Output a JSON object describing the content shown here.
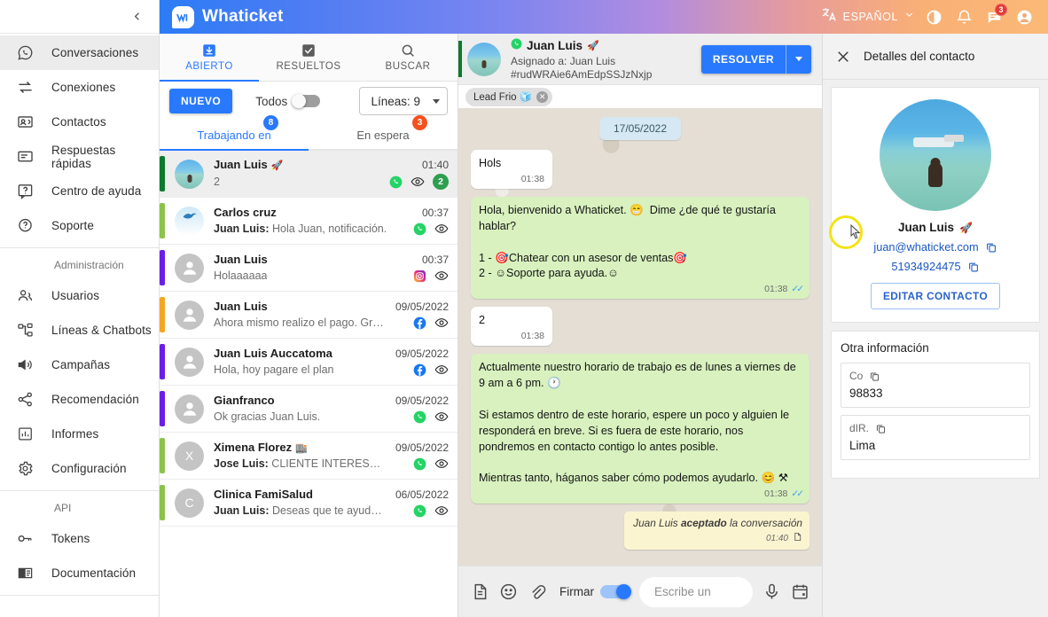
{
  "topbar": {
    "brand": "Whaticket",
    "language": "ESPAÑOL",
    "icons": {
      "translate": "translate-icon",
      "chevron": "chevron-down-icon",
      "dark_mode": "dark-mode-icon",
      "notifications": "bell-icon",
      "messages": "chat-icon",
      "profile": "account-circle-icon"
    },
    "messages_badge": "3"
  },
  "sidebar": {
    "collapse_icon": "chevron-left-icon",
    "items": [
      {
        "label": "Conversaciones",
        "icon": "whatsapp-chat-icon",
        "active": true
      },
      {
        "label": "Conexiones",
        "icon": "sync-arrows-icon",
        "active": false
      },
      {
        "label": "Contactos",
        "icon": "contacts-card-icon",
        "active": false
      },
      {
        "label": "Respuestas rápidas",
        "icon": "quick-reply-icon",
        "active": false
      },
      {
        "label": "Centro de ayuda",
        "icon": "help-center-icon",
        "active": false
      },
      {
        "label": "Soporte",
        "icon": "support-question-icon",
        "active": false
      }
    ],
    "section_admin": "Administración",
    "admin_items": [
      {
        "label": "Usuarios",
        "icon": "people-icon"
      },
      {
        "label": "Líneas & Chatbots",
        "icon": "chatbot-nodes-icon"
      },
      {
        "label": "Campañas",
        "icon": "megaphone-icon"
      },
      {
        "label": "Recomendación",
        "icon": "share-icon"
      },
      {
        "label": "Informes",
        "icon": "bar-chart-icon"
      },
      {
        "label": "Configuración",
        "icon": "gear-icon"
      }
    ],
    "section_api": "API",
    "api_items": [
      {
        "label": "Tokens",
        "icon": "key-icon"
      },
      {
        "label": "Documentación",
        "icon": "book-icon"
      }
    ]
  },
  "tickets": {
    "tabs": [
      {
        "label": "ABIERTO",
        "icon": "inbox-download-icon",
        "active": true
      },
      {
        "label": "RESUELTOS",
        "icon": "check-box-icon",
        "active": false
      },
      {
        "label": "BUSCAR",
        "icon": "search-icon",
        "active": false
      }
    ],
    "new_button": "NUEVO",
    "todos_label": "Todos",
    "todos_on": false,
    "lines_select": "Líneas: 9",
    "subtabs": [
      {
        "label": "Trabajando en",
        "badge": "8",
        "badge_color": "#2979ff",
        "active": true
      },
      {
        "label": "En espera",
        "badge": "3",
        "badge_color": "#f4511e",
        "active": false
      }
    ],
    "rows": [
      {
        "name": "Juan Luis",
        "emoji": "🚀",
        "time": "01:40",
        "preview": "",
        "preview_prefix": "",
        "message": "2",
        "channel": "whatsapp",
        "strip": "#0d7a2e",
        "avatar": "beach",
        "unread": "2",
        "selected": true
      },
      {
        "name": "Carlos cruz",
        "emoji": "",
        "time": "00:37",
        "preview_prefix": "Juan Luis:",
        "message": "Hola Juan, notificación.",
        "channel": "whatsapp",
        "strip": "#8bc34a",
        "avatar": "logo",
        "unread": "",
        "selected": false
      },
      {
        "name": "Juan Luis",
        "emoji": "",
        "time": "00:37",
        "preview_prefix": "",
        "message": "Holaaaaaa",
        "channel": "instagram",
        "strip": "#6a1ee8",
        "avatar": "person",
        "unread": "",
        "selected": false
      },
      {
        "name": "Juan Luis",
        "emoji": "",
        "time": "09/05/2022",
        "preview_prefix": "",
        "message": "Ahora mismo realizo el pago. Gracias",
        "channel": "facebook",
        "strip": "#f5a623",
        "avatar": "person",
        "unread": "",
        "selected": false
      },
      {
        "name": "Juan Luis Auccatoma",
        "emoji": "",
        "time": "09/05/2022",
        "preview_prefix": "",
        "message": "Hola, hoy pagare el plan",
        "channel": "facebook",
        "strip": "#6a1ee8",
        "avatar": "person",
        "unread": "",
        "selected": false
      },
      {
        "name": "Gianfranco",
        "emoji": "",
        "time": "09/05/2022",
        "preview_prefix": "",
        "message": "Ok gracias Juan Luis.",
        "channel": "whatsapp",
        "strip": "#6a1ee8",
        "avatar": "person",
        "unread": "",
        "selected": false
      },
      {
        "name": "Ximena Florez",
        "emoji": "🏬",
        "time": "09/05/2022",
        "preview_prefix": "Jose Luis:",
        "message": "CLIENTE INTERESADO, P...",
        "channel": "whatsapp",
        "strip": "#8bc34a",
        "avatar": "letter",
        "avatar_letter": "X",
        "unread": "",
        "selected": false
      },
      {
        "name": "Clinica FamiSalud",
        "emoji": "",
        "time": "06/05/2022",
        "preview_prefix": "Juan Luis:",
        "message": "Deseas que te ayude con ...",
        "channel": "whatsapp",
        "strip": "#8bc34a",
        "avatar": "letter",
        "avatar_letter": "C",
        "unread": "",
        "selected": false
      }
    ]
  },
  "chat": {
    "contact_name": "Juan Luis",
    "contact_emoji": "🚀",
    "assigned_to": "Asignado a: Juan Luis",
    "ticket_id": "#rudWRAie6AmEdpSSJzNxjp",
    "resolve_button": "RESOLVER",
    "tag": "Lead Frio 🧊",
    "date_divider": "17/05/2022",
    "messages": [
      {
        "dir": "in",
        "text": "Hols",
        "time": "01:38"
      },
      {
        "dir": "out",
        "text": "Hola, bienvenido a Whaticket. 😁  Dime ¿de qué te gustaría hablar?\n\n1 - 🎯Chatear con un asesor de ventas🎯\n2 - ☺Soporte para ayuda.☺",
        "time": "01:38",
        "status": "read"
      },
      {
        "dir": "in",
        "text": "2",
        "time": "01:38"
      },
      {
        "dir": "out",
        "text": "Actualmente nuestro horario de trabajo es de lunes a viernes de 9 am a 6 pm. 🕐\n\nSi estamos dentro de este horario, espere un poco y alguien le responderá en breve. Si es fuera de este horario, nos pondremos en contacto contigo lo antes posible.\n\nMientras tanto, háganos saber cómo podemos ayudarlo. 😊 ⚒",
        "time": "01:38",
        "status": "read"
      }
    ],
    "note": {
      "prefix": "Juan Luis ",
      "bold": "aceptado",
      "suffix": " la conversación",
      "time": "01:40"
    },
    "composer": {
      "placeholder": "Escribe un",
      "input_value": "",
      "sign_label": "Firmar",
      "sign_on": true,
      "icons": [
        "document-icon",
        "emoji-icon",
        "attachment-clip-icon",
        "microphone-icon",
        "calendar-icon"
      ]
    }
  },
  "details": {
    "title": "Detalles del contacto",
    "close_icon": "close-icon",
    "contact_name": "Juan Luis",
    "contact_emoji": "🚀",
    "email": "juan@whaticket.com",
    "phone": "51934924475",
    "edit_button": "EDITAR CONTACTO",
    "other_title": "Otra información",
    "fields": [
      {
        "key": "Co",
        "value": "98833"
      },
      {
        "key": "dIR.",
        "value": "Lima"
      }
    ]
  }
}
